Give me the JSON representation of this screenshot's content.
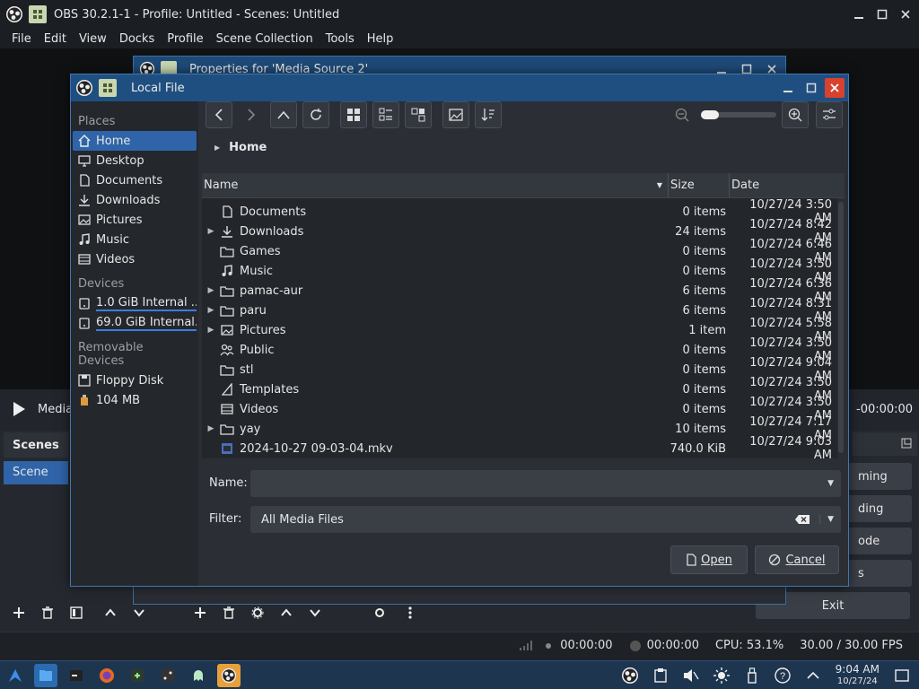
{
  "obs": {
    "title": "OBS 30.2.1-1 - Profile: Untitled - Scenes: Untitled",
    "menu": [
      "File",
      "Edit",
      "View",
      "Docks",
      "Profile",
      "Scene Collection",
      "Tools",
      "Help"
    ],
    "media_label": "Media",
    "media_time": "-00:00:00",
    "scenes_title": "Scenes",
    "scene_item": "Scene",
    "controls": [
      "ming",
      "ding",
      "ode",
      "s"
    ],
    "exit_label": "Exit",
    "status": {
      "dropped": "00:00:00",
      "rec": "00:00:00",
      "cpu": "CPU: 53.1%",
      "fps": "30.00 / 30.00 FPS"
    }
  },
  "props": {
    "title": "Properties for 'Media Source 2'"
  },
  "dialog": {
    "title": "Local File",
    "breadcrumb": "Home",
    "places": {
      "section_places": "Places",
      "items": [
        "Home",
        "Desktop",
        "Documents",
        "Downloads",
        "Pictures",
        "Music",
        "Videos"
      ],
      "section_devices": "Devices",
      "devices": [
        "1.0 GiB Internal ...",
        "69.0 GiB Internal..."
      ],
      "section_removable": "Removable Devices",
      "removable": [
        "Floppy Disk",
        "104 MB"
      ]
    },
    "columns": {
      "name": "Name",
      "size": "Size",
      "date": "Date"
    },
    "files": [
      {
        "name": "Documents",
        "size": "0 items",
        "date": "10/27/24 3:50 AM",
        "icon": "documents-folder-icon",
        "expandable": false
      },
      {
        "name": "Downloads",
        "size": "24 items",
        "date": "10/27/24 8:42 AM",
        "icon": "downloads-folder-icon",
        "expandable": true
      },
      {
        "name": "Games",
        "size": "0 items",
        "date": "10/27/24 6:46 AM",
        "icon": "folder-icon",
        "expandable": false
      },
      {
        "name": "Music",
        "size": "0 items",
        "date": "10/27/24 3:50 AM",
        "icon": "music-folder-icon",
        "expandable": false
      },
      {
        "name": "pamac-aur",
        "size": "6 items",
        "date": "10/27/24 6:36 AM",
        "icon": "folder-icon",
        "expandable": true
      },
      {
        "name": "paru",
        "size": "6 items",
        "date": "10/27/24 8:31 AM",
        "icon": "folder-icon",
        "expandable": true
      },
      {
        "name": "Pictures",
        "size": "1 item",
        "date": "10/27/24 5:58 AM",
        "icon": "pictures-folder-icon",
        "expandable": true
      },
      {
        "name": "Public",
        "size": "0 items",
        "date": "10/27/24 3:50 AM",
        "icon": "public-folder-icon",
        "expandable": false
      },
      {
        "name": "stl",
        "size": "0 items",
        "date": "10/27/24 9:04 AM",
        "icon": "folder-icon",
        "expandable": false
      },
      {
        "name": "Templates",
        "size": "0 items",
        "date": "10/27/24 3:50 AM",
        "icon": "templates-folder-icon",
        "expandable": false
      },
      {
        "name": "Videos",
        "size": "0 items",
        "date": "10/27/24 3:50 AM",
        "icon": "videos-folder-icon",
        "expandable": false
      },
      {
        "name": "yay",
        "size": "10 items",
        "date": "10/27/24 7:17 AM",
        "icon": "folder-icon",
        "expandable": true
      },
      {
        "name": "2024-10-27 09-03-04.mkv",
        "size": "740.0 KiB",
        "date": "10/27/24 9:03 AM",
        "icon": "video-file-icon",
        "expandable": false
      }
    ],
    "name_label": "Name:",
    "name_value": "",
    "filter_label": "Filter:",
    "filter_value": "All Media Files",
    "open_label": "Open",
    "cancel_label": "Cancel"
  },
  "taskbar": {
    "time": "9:04 AM",
    "date": "10/27/24"
  },
  "colors": {
    "accent": "#2f64a8",
    "titlebar_active": "#1f4f80",
    "taskbar": "#1e3550",
    "close_button": "#d9412f"
  }
}
